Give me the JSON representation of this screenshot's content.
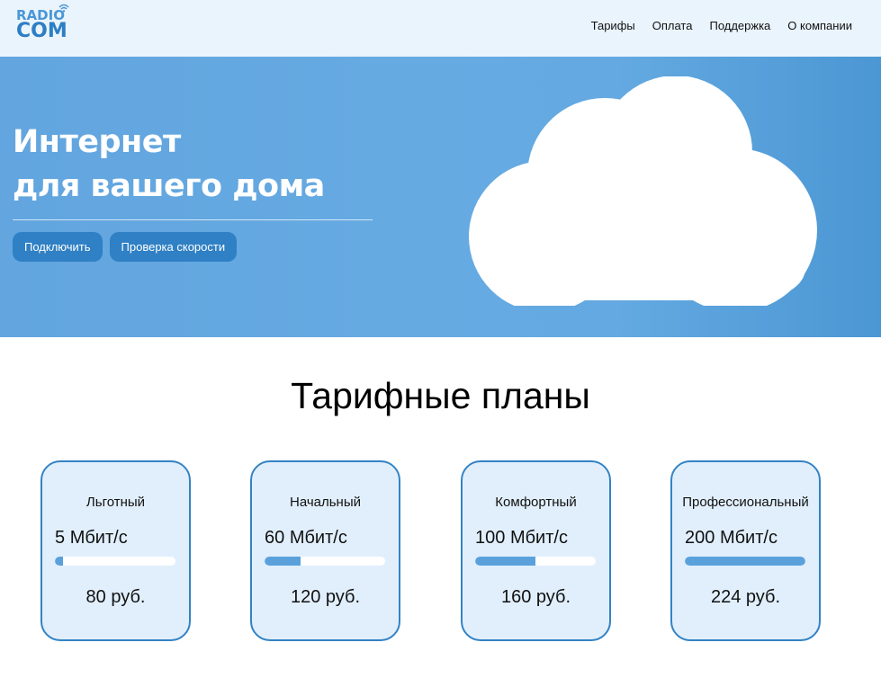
{
  "logo": {
    "top": "RADIO",
    "bottom": "COM"
  },
  "nav": [
    "Тарифы",
    "Оплата",
    "Поддержка",
    "О компании"
  ],
  "hero": {
    "title_line1": "Интернет",
    "title_line2": "для вашего дома",
    "buttons": [
      "Подключить",
      "Проверка скорости"
    ]
  },
  "plans": {
    "title": "Тарифные планы",
    "items": [
      {
        "name": "Льготный",
        "speed": "5",
        "unit": "Мбит/с",
        "price": "80 руб.",
        "level": 0.07
      },
      {
        "name": "Начальный",
        "speed": "60",
        "unit": "Мбит/с",
        "price": "120 руб.",
        "level": 0.3
      },
      {
        "name": "Комфортный",
        "speed": "100",
        "unit": "Мбит/с",
        "price": "160 руб.",
        "level": 0.5
      },
      {
        "name": "Профессиональный",
        "speed": "200",
        "unit": "Мбит/с",
        "price": "224 руб.",
        "level": 1.0
      }
    ]
  },
  "colors": {
    "accent": "#2f80c4",
    "card_bg": "#e1effc",
    "hero": "#62a5df"
  }
}
